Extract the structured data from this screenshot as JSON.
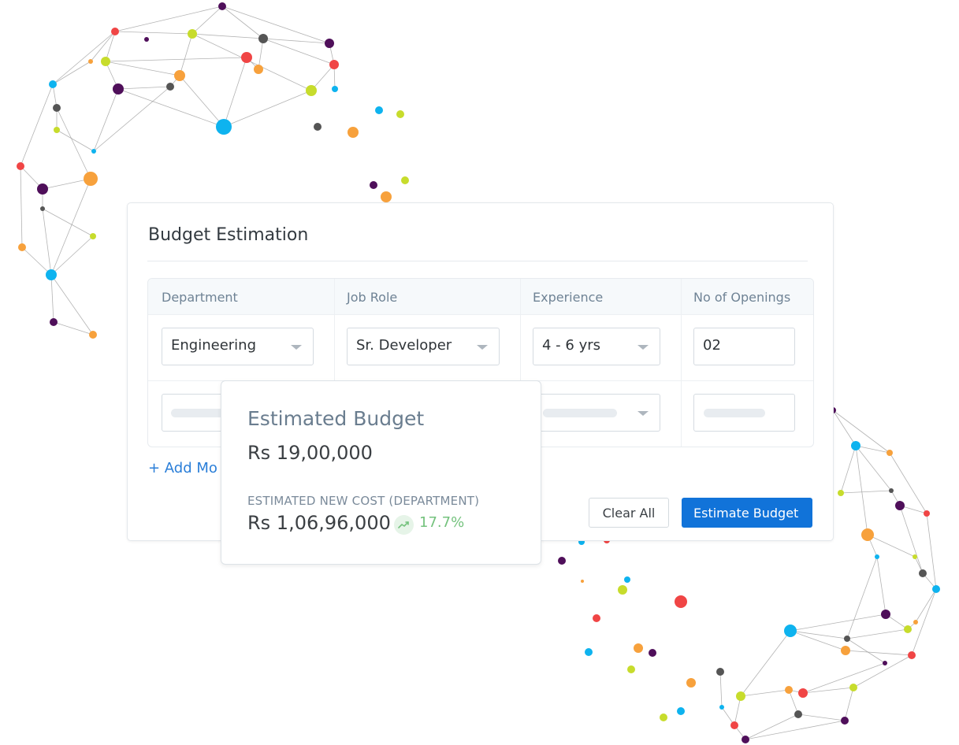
{
  "card": {
    "title": "Budget Estimation",
    "columns": [
      "Department",
      "Job Role",
      "Experience",
      "No of Openings"
    ],
    "rows": [
      {
        "department": "Engineering",
        "job_role": "Sr. Developer",
        "experience": "4 - 6 yrs",
        "openings": "02"
      },
      {
        "department": "",
        "job_role": "",
        "experience": "",
        "openings": ""
      }
    ],
    "add_more_label": "+ Add Mo",
    "clear_label": "Clear All",
    "estimate_label": "Estimate Budget"
  },
  "popover": {
    "title": "Estimated Budget",
    "amount": "Rs 19,00,000",
    "new_cost_label": "ESTIMATED NEW COST (DEPARTMENT)",
    "new_cost_amount": "Rs 1,06,96,000",
    "trend_icon": "trending-up-icon",
    "trend_percent": "17.7%"
  },
  "colors": {
    "primary": "#1173d9",
    "link": "#2a7ed8",
    "trend_up": "#74c27d",
    "network_palette": [
      "#4f0f5a",
      "#f04545",
      "#c7dc2c",
      "#f7a13c",
      "#0eb3ef",
      "#555555"
    ]
  }
}
